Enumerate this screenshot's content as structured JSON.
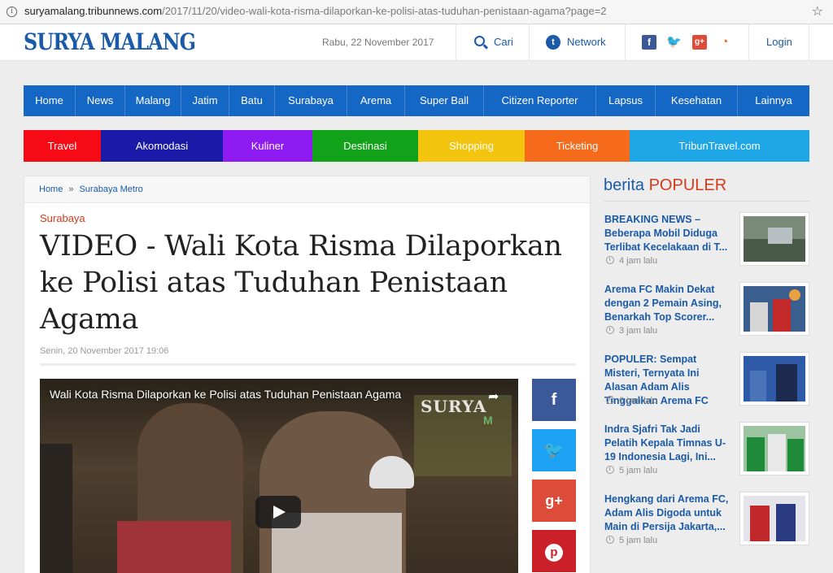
{
  "browser": {
    "url_host": "suryamalang.tribunnews.com",
    "url_path": "/2017/11/20/video-wali-kota-risma-dilaporkan-ke-polisi-atas-tuduhan-penistaan-agama?page=2"
  },
  "header": {
    "logo": "SURYA MALANG",
    "date": "Rabu, 22 November 2017",
    "search_label": "Cari",
    "network_label": "Network",
    "login_label": "Login"
  },
  "nav": {
    "items": [
      "Home",
      "News",
      "Malang",
      "Jatim",
      "Batu",
      "Surabaya",
      "Arema",
      "Super Ball",
      "Citizen Reporter",
      "Lapsus",
      "Kesehatan",
      "Lainnya"
    ]
  },
  "categories": {
    "items": [
      "Travel",
      "Akomodasi",
      "Kuliner",
      "Destinasi",
      "Shopping",
      "Ticketing",
      "TribunTravel.com"
    ],
    "colors": [
      "#f50a16",
      "#1a1aa8",
      "#8e1cf2",
      "#11a21a",
      "#f3c50f",
      "#f56a1b",
      "#1fa6e7"
    ]
  },
  "breadcrumb": {
    "home": "Home",
    "separator": "»",
    "section": "Surabaya Metro"
  },
  "article": {
    "kanal": "Surabaya",
    "title": "VIDEO - Wali Kota Risma Dilaporkan ke Polisi atas Tuduhan Penistaan Agama",
    "date": "Senin, 20 November 2017 19:06",
    "video_title": "Wali Kota Risma Dilaporkan ke Polisi atas Tuduhan Penistaan Agama",
    "video_watermark": "SURYA",
    "video_watermark_small": "M"
  },
  "share": {
    "facebook_icon": "f",
    "twitter_icon": "🐦",
    "gplus_icon": "g+",
    "pinterest_icon": "p"
  },
  "sidebar": {
    "title_prefix": "berita",
    "title_highlight": "POPULER",
    "items": [
      {
        "title": "BREAKING NEWS – Beberapa Mobil Diduga Terlibat Kecelakaan di T...",
        "time": "4 jam lalu"
      },
      {
        "title": "Arema FC Makin Dekat dengan 2 Pemain Asing, Benarkah Top Scorer...",
        "time": "3 jam lalu"
      },
      {
        "title": "POPULER: Sempat Misteri, Ternyata Ini Alasan Adam Alis Tinggalkan Arema FC",
        "time": "6 jam lalu"
      },
      {
        "title": "Indra Sjafri Tak Jadi Pelatih Kepala Timnas U-19 Indonesia Lagi, Ini...",
        "time": "5 jam lalu"
      },
      {
        "title": "Hengkang dari Arema FC, Adam Alis Digoda untuk Main di Persija Jakarta,...",
        "time": "5 jam lalu"
      }
    ]
  }
}
